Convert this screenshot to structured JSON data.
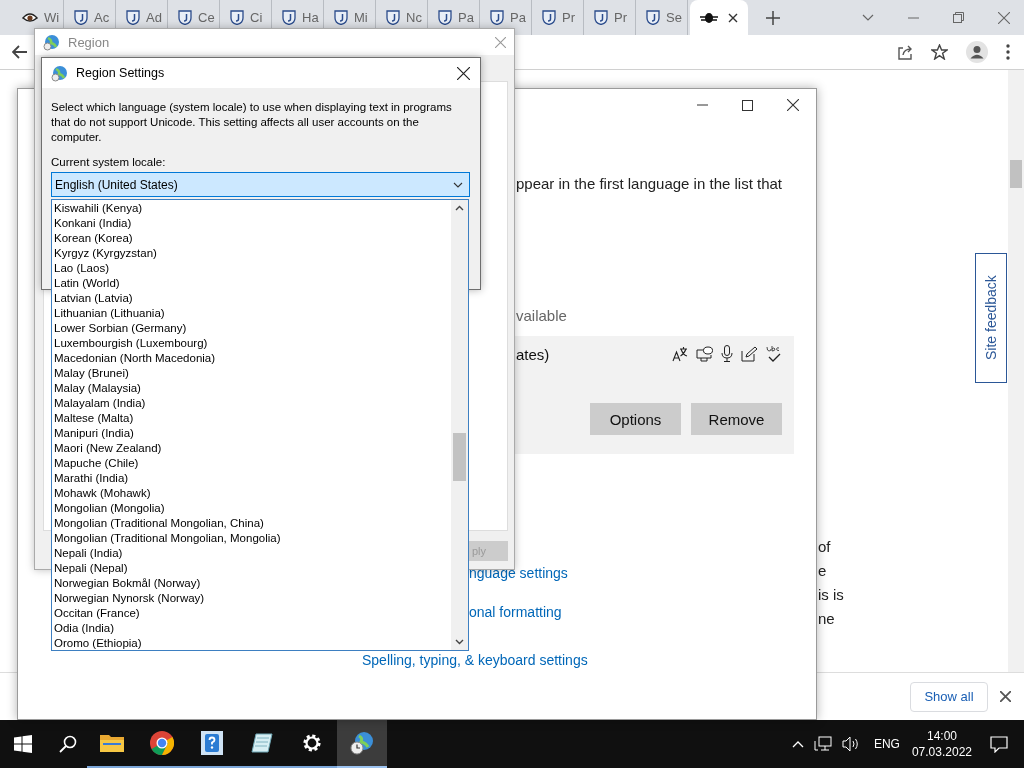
{
  "browser": {
    "tabs": [
      {
        "kind": "eye",
        "label": "Wi",
        "selected": false
      },
      {
        "kind": "shield",
        "label": "Ac",
        "selected": false
      },
      {
        "kind": "shield",
        "label": "Ad",
        "selected": false
      },
      {
        "kind": "shield",
        "label": "Ce",
        "selected": false
      },
      {
        "kind": "shield",
        "label": "Ci",
        "selected": false
      },
      {
        "kind": "shield",
        "label": "Ha",
        "selected": false
      },
      {
        "kind": "shield",
        "label": "Mi",
        "selected": false
      },
      {
        "kind": "shield",
        "label": "Nc",
        "selected": false
      },
      {
        "kind": "shield",
        "label": "Pa",
        "selected": false
      },
      {
        "kind": "shield",
        "label": "Pa",
        "selected": false
      },
      {
        "kind": "shield",
        "label": "Pr",
        "selected": false
      },
      {
        "kind": "shield",
        "label": "Pr",
        "selected": false
      },
      {
        "kind": "shield",
        "label": "Se",
        "selected": false
      },
      {
        "kind": "emblem",
        "selected": true
      }
    ],
    "page": {
      "text_fragments": [
        "of",
        "e",
        "is is",
        "ne"
      ],
      "site_feedback": "Site feedback"
    },
    "download_bar": {
      "show_all": "Show all"
    }
  },
  "settings_window": {
    "intro_fragment": "ppear in the first language in the list that",
    "available_fragment": "vailable",
    "language_card": {
      "name_fragment": "ates)",
      "buttons": [
        "Options",
        "Remove"
      ]
    },
    "links": [
      "nguage settings",
      "onal formatting",
      "Spelling, typing, & keyboard settings"
    ]
  },
  "region_dialog": {
    "title": "Region",
    "apply": {
      "label": "ply",
      "disabled": true
    }
  },
  "region_settings": {
    "title": "Region Settings",
    "description": "Select which language (system locale) to use when displaying text in programs that do not support Unicode. This setting affects all user accounts on the computer.",
    "locale_label": "Current system locale:",
    "locale_value": "English (United States)",
    "options": [
      "Kiswahili (Kenya)",
      "Konkani (India)",
      "Korean (Korea)",
      "Kyrgyz (Kyrgyzstan)",
      "Lao (Laos)",
      "Latin (World)",
      "Latvian (Latvia)",
      "Lithuanian (Lithuania)",
      "Lower Sorbian (Germany)",
      "Luxembourgish (Luxembourg)",
      "Macedonian (North Macedonia)",
      "Malay (Brunei)",
      "Malay (Malaysia)",
      "Malayalam (India)",
      "Maltese (Malta)",
      "Manipuri (India)",
      "Maori (New Zealand)",
      "Mapuche (Chile)",
      "Marathi (India)",
      "Mohawk (Mohawk)",
      "Mongolian (Mongolia)",
      "Mongolian (Traditional Mongolian, China)",
      "Mongolian (Traditional Mongolian, Mongolia)",
      "Nepali (India)",
      "Nepali (Nepal)",
      "Norwegian Bokmål (Norway)",
      "Norwegian Nynorsk (Norway)",
      "Occitan (France)",
      "Odia (India)",
      "Oromo (Ethiopia)"
    ]
  },
  "taskbar": {
    "apps": [
      {
        "kind": "folder",
        "selected": false
      },
      {
        "kind": "chrome",
        "selected": false
      },
      {
        "kind": "help",
        "selected": false
      },
      {
        "kind": "notepad",
        "selected": false
      },
      {
        "kind": "gear",
        "selected": false
      },
      {
        "kind": "globe",
        "selected": true
      }
    ],
    "language": "ENG",
    "time": "14:00",
    "date": "07.03.2022"
  }
}
